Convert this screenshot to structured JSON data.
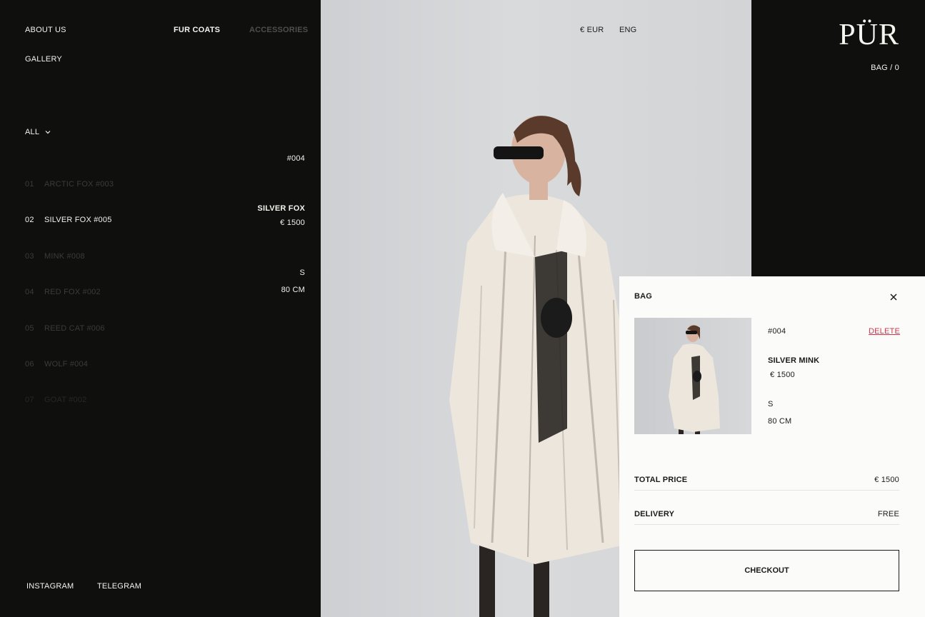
{
  "nav": {
    "about": "ABOUT US",
    "gallery": "GALLERY",
    "fur_coats": "FUR COATS",
    "accessories": "ACCESSORIES"
  },
  "filter": {
    "label": "ALL"
  },
  "catalog": [
    {
      "num": "01",
      "name": "ARCTIC FOX #003"
    },
    {
      "num": "02",
      "name": "SILVER FOX #005"
    },
    {
      "num": "03",
      "name": "MINK #008"
    },
    {
      "num": "04",
      "name": "RED FOX #002"
    },
    {
      "num": "05",
      "name": "REED CAT #006"
    },
    {
      "num": "06",
      "name": "WOLF #004"
    },
    {
      "num": "07",
      "name": "GOAT #002"
    }
  ],
  "detail": {
    "sku": "#004",
    "name": "SILVER FOX",
    "price": "€ 1500",
    "size": "S",
    "length": "80 CM"
  },
  "social": {
    "instagram": "INSTAGRAM",
    "telegram": "TELEGRAM"
  },
  "header": {
    "currency": "€ EUR",
    "language": "ENG",
    "logo": "PÜR",
    "bag": "BAG / 0"
  },
  "bag": {
    "title": "BAG",
    "item": {
      "sku": "#004",
      "delete": "DELETE",
      "name": "SILVER MINK",
      "price": "€ 1500",
      "size": "S",
      "length": "80 CM"
    },
    "total_label": "TOTAL PRICE",
    "total_value": "€ 1500",
    "delivery_label": "DELIVERY",
    "delivery_value": "FREE",
    "checkout": "CHECKOUT"
  },
  "colors": {
    "background": "#0f100d",
    "accent_delete": "#d2354b",
    "photo_bg": "#d6d8da"
  }
}
